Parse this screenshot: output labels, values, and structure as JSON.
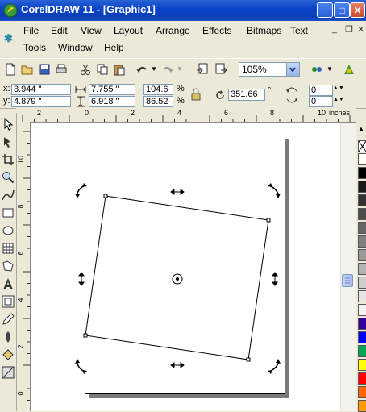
{
  "window": {
    "title": "CorelDRAW 11 - [Graphic1]"
  },
  "menu": [
    "File",
    "Edit",
    "View",
    "Layout",
    "Arrange",
    "Effects",
    "Bitmaps",
    "Text",
    "Tools",
    "Window",
    "Help"
  ],
  "toolbar": {
    "zoom": "105%"
  },
  "properties": {
    "x_label": "x:",
    "x": "3.944 \"",
    "y_label": "y:",
    "y": "4.879 \"",
    "width": "7.755 \"",
    "height": "6.918 \"",
    "scale_x": "104.6",
    "scale_y": "86.52",
    "percent": "%",
    "rotation": "351.66",
    "degree": "°",
    "nudge1": "0",
    "nudge2": "0"
  },
  "ruler": {
    "top_ticks": [
      "2",
      "0",
      "2",
      "4",
      "6",
      "8",
      "10"
    ],
    "unit": "inches",
    "left_ticks": [
      "10",
      "8",
      "6",
      "4",
      "2",
      "0"
    ]
  },
  "colors": {
    "title_bar": "#0a44c9",
    "palette": [
      "#ffffff",
      "#000000",
      "#1a1a1a",
      "#333333",
      "#4d4d4d",
      "#666666",
      "#808080",
      "#999999",
      "#b3b3b3",
      "#cccccc",
      "#e6e6e6",
      "#f2f2f2",
      "#330099",
      "#0000ff",
      "#00a651",
      "#ffff00",
      "#ff0000",
      "#ff6600",
      "#ff9900"
    ]
  },
  "icons": [
    "coreldraw-logo-icon",
    "new-icon",
    "open-icon",
    "save-icon",
    "print-icon",
    "cut-icon",
    "copy-icon",
    "paste-icon",
    "undo-icon",
    "redo-icon",
    "import-icon",
    "export-icon",
    "application-launcher-icon",
    "corel-online-icon",
    "lock-ratio-icon",
    "rotation-icon",
    "mirror-horizontal-icon",
    "mirror-vertical-icon",
    "pick-tool-icon",
    "shape-tool-icon",
    "crop-tool-icon",
    "zoom-tool-icon",
    "freehand-tool-icon",
    "rectangle-tool-icon",
    "ellipse-tool-icon",
    "polygon-tool-icon",
    "basic-shapes-icon",
    "text-tool-icon",
    "interactive-blend-icon",
    "eyedropper-icon",
    "outline-tool-icon",
    "fill-tool-icon",
    "interactive-fill-icon",
    "center-marker-icon"
  ]
}
